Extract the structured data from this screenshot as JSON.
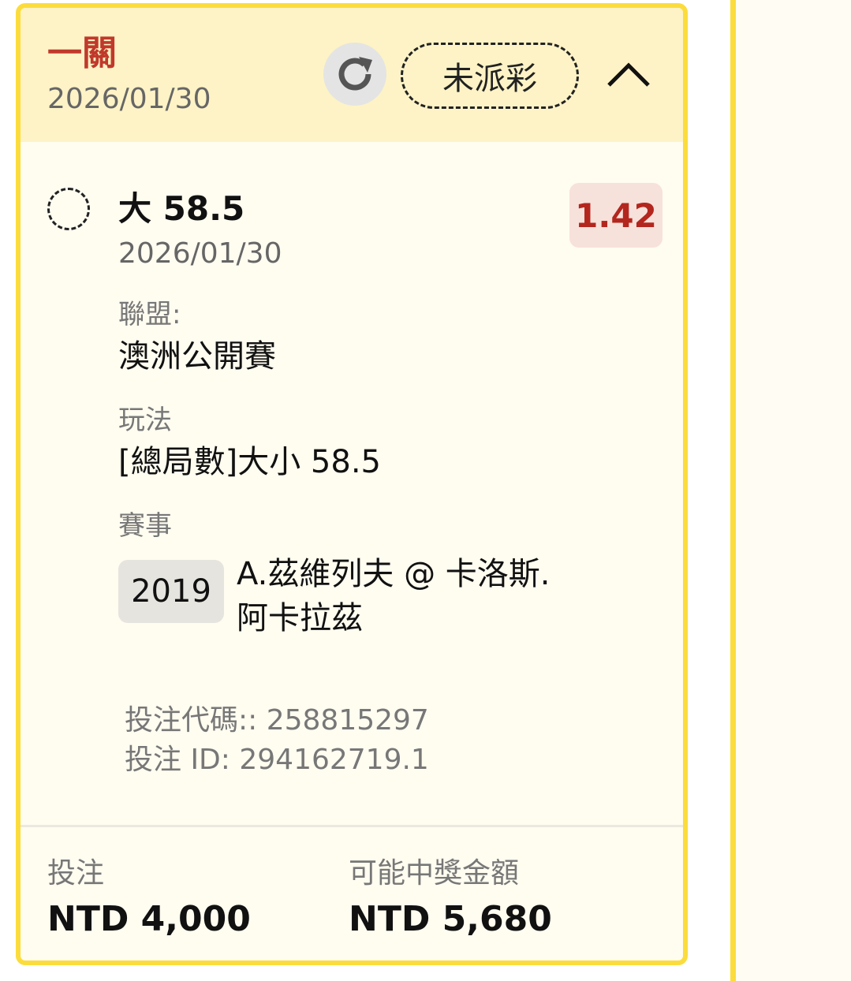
{
  "header": {
    "title": "一關",
    "date": "2026/01/30",
    "status": "未派彩"
  },
  "selection": {
    "name": "大 58.5",
    "date": "2026/01/30",
    "odds": "1.42"
  },
  "details": {
    "league_label": "聯盟:",
    "league_value": "澳洲公開賽",
    "bet_type_label": "玩法",
    "bet_type_value": "[總局數]大小 58.5",
    "event_label": "賽事",
    "event_id": "2019",
    "event_name": "A.茲維列夫 @ 卡洛斯.阿卡拉茲",
    "bet_code": "投注代碼:: 258815297",
    "bet_id": "投注 ID: 294162719.1"
  },
  "footer": {
    "stake_label": "投注",
    "stake_value": "NTD 4,000",
    "payout_label": "可能中獎金額",
    "payout_value": "NTD 5,680"
  },
  "colors": {
    "border": "#fbdc3c",
    "header_bg": "#fdf3c6",
    "title_red": "#c0392b",
    "odds_bg": "#f7e1db"
  },
  "icons": {
    "refresh": "refresh-icon",
    "collapse": "chevron-up-icon",
    "selection": "dashed-circle-icon"
  }
}
